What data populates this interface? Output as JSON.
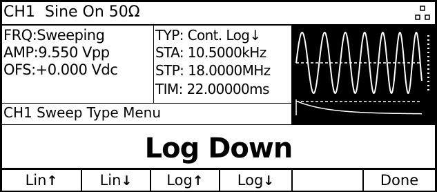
{
  "status": {
    "channel": "CH1",
    "state": "Sine On 50Ω",
    "icon": "channel-display-icon"
  },
  "params": {
    "frq": "FRQ:Sweeping",
    "amp": "AMP:9.550 Vpp",
    "ofs": "OFS:+0.000 Vdc"
  },
  "sweep": {
    "typ": "TYP: Cont. Log↓",
    "sta": "STA: 10.5000kHz",
    "stp": "STP: 18.0000MHz",
    "tim": "TIM:  22.00000ms"
  },
  "menu_title": "CH1 Sweep Type Menu",
  "selected_value": "Log Down",
  "softkeys": [
    {
      "label": "Lin",
      "arrow": "↑"
    },
    {
      "label": "Lin",
      "arrow": "↓"
    },
    {
      "label": "Log",
      "arrow": "↑"
    },
    {
      "label": "Log",
      "arrow": "↓"
    },
    {
      "label": "",
      "arrow": ""
    },
    {
      "label": "Done",
      "arrow": ""
    }
  ],
  "colors": {
    "background": "#000000",
    "panel": "#ffffff",
    "text": "#000000",
    "waveform": "#ffffff"
  }
}
